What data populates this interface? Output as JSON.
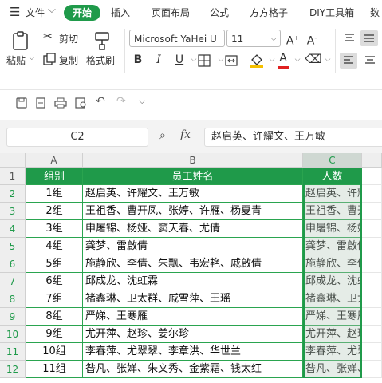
{
  "menubar": {
    "file_label": "文件",
    "tabs": [
      "开始",
      "插入",
      "页面布局",
      "公式",
      "方方格子",
      "DIY工具箱",
      "数"
    ]
  },
  "ribbon": {
    "paste": "粘贴",
    "cut": "剪切",
    "copy": "复制",
    "format_painter": "格式刷",
    "font_name": "Microsoft YaHei U",
    "font_size": "11"
  },
  "formula_bar": {
    "name_box": "C2",
    "fx": "fx",
    "formula": "赵启英、许耀文、王万敏"
  },
  "sheet": {
    "columns": [
      "A",
      "B",
      "C"
    ],
    "header": [
      "组别",
      "员工姓名",
      "人数"
    ],
    "rows": [
      {
        "num": "1"
      },
      {
        "num": "2",
        "a": "1组",
        "b": "赵启英、许耀文、王万敏",
        "c": "赵启英、许耀文"
      },
      {
        "num": "3",
        "a": "2组",
        "b": "王祖香、曹开凤、张婷、许雁、杨夏青",
        "c": "王祖香、曹开凤"
      },
      {
        "num": "4",
        "a": "3组",
        "b": "申屠锦、杨娅、窦天春、尤倩",
        "c": "申屠锦、杨娅"
      },
      {
        "num": "5",
        "a": "4组",
        "b": "龚梦、雷啟倩",
        "c": "龚梦、雷啟倩"
      },
      {
        "num": "6",
        "a": "5组",
        "b": "施静欣、李倩、朱飘、韦宏艳、戚啟倩",
        "c": "施静欣、李倩、"
      },
      {
        "num": "7",
        "a": "6组",
        "b": "邱成龙、沈虹霖",
        "c": "邱成龙、沈虹霖"
      },
      {
        "num": "8",
        "a": "7组",
        "b": "褚鑫琳、卫太群、戚雪萍、王瑶",
        "c": "褚鑫琳、卫太群"
      },
      {
        "num": "9",
        "a": "8组",
        "b": "严娣、王寒雁",
        "c": "严娣、王寒雁"
      },
      {
        "num": "10",
        "a": "9组",
        "b": "尤开萍、赵珍、姜尔珍",
        "c": "尤开萍、赵珍、"
      },
      {
        "num": "11",
        "a": "10组",
        "b": "李春萍、尤翠翠、李章洪、华世兰",
        "c": "李春萍、尤翠翠"
      },
      {
        "num": "12",
        "a": "11组",
        "b": "昝凡、张婵、朱文秀、金紫霜、钱太红",
        "c": "昝凡、张婵、朱"
      }
    ]
  }
}
